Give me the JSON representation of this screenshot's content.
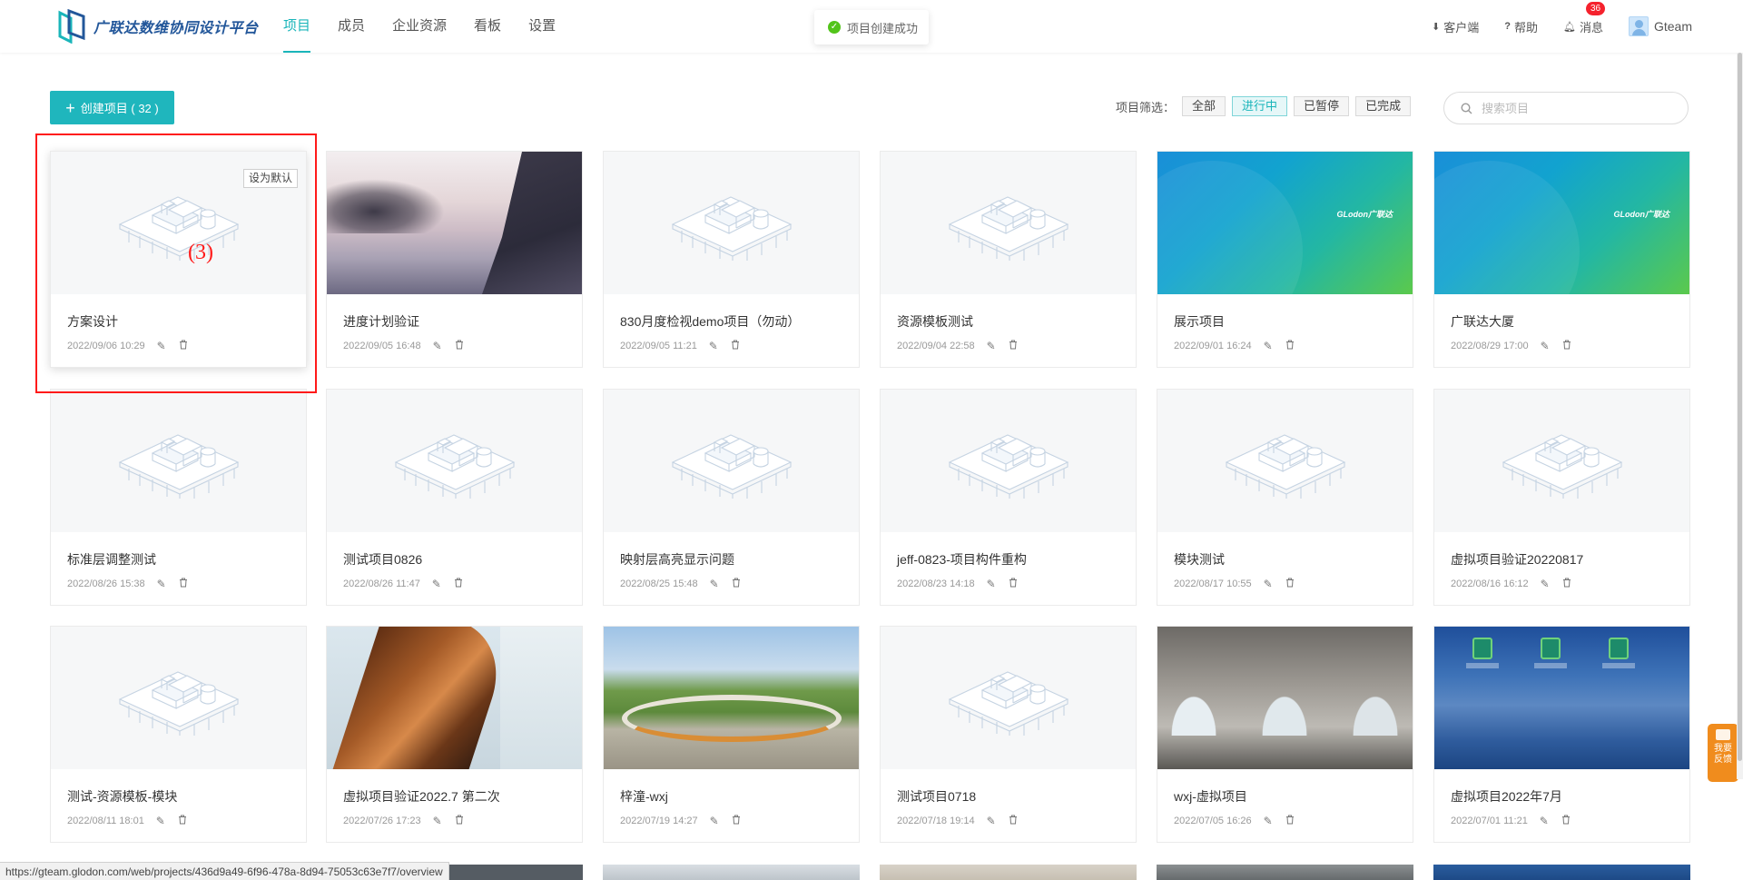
{
  "app": {
    "title": "广联达数维协同设计平台"
  },
  "nav": [
    {
      "label": "项目",
      "active": true
    },
    {
      "label": "成员",
      "active": false
    },
    {
      "label": "企业资源",
      "active": false
    },
    {
      "label": "看板",
      "active": false
    },
    {
      "label": "设置",
      "active": false
    }
  ],
  "toast": {
    "message": "项目创建成功"
  },
  "header_right": {
    "client": "客户端",
    "help": "帮助",
    "messages": "消息",
    "message_count": "36",
    "user": "Gteam"
  },
  "toolbar": {
    "create_label": "创建项目 ( 32 )",
    "filter_label": "项目筛选：",
    "filters": [
      {
        "label": "全部",
        "active": false
      },
      {
        "label": "进行中",
        "active": true
      },
      {
        "label": "已暂停",
        "active": false
      },
      {
        "label": "已完成",
        "active": false
      }
    ],
    "search_placeholder": "搜索项目"
  },
  "default_tag": "设为默认",
  "annotation": "(3)",
  "projects": [
    {
      "name": "方案设计",
      "date": "2022/09/06 10:29",
      "thumb": "placeholder"
    },
    {
      "name": "进度计划验证",
      "date": "2022/09/05 16:48",
      "thumb": "lake"
    },
    {
      "name": "830月度检视demo项目（勿动）",
      "date": "2022/09/05 11:21",
      "thumb": "placeholder"
    },
    {
      "name": "资源模板测试",
      "date": "2022/09/04 22:58",
      "thumb": "placeholder"
    },
    {
      "name": "展示项目",
      "date": "2022/09/01 16:24",
      "thumb": "glodon"
    },
    {
      "name": "广联达大厦",
      "date": "2022/08/29 17:00",
      "thumb": "glodon"
    },
    {
      "name": "标准层调整测试",
      "date": "2022/08/26 15:38",
      "thumb": "placeholder"
    },
    {
      "name": "测试项目0826",
      "date": "2022/08/26 11:47",
      "thumb": "placeholder"
    },
    {
      "name": "映射层高亮显示问题",
      "date": "2022/08/25 15:48",
      "thumb": "placeholder"
    },
    {
      "name": "jeff-0823-项目构件重构",
      "date": "2022/08/23 14:18",
      "thumb": "placeholder"
    },
    {
      "name": "模块测试",
      "date": "2022/08/17 10:55",
      "thumb": "placeholder"
    },
    {
      "name": "虚拟项目验证20220817",
      "date": "2022/08/16 16:12",
      "thumb": "placeholder"
    },
    {
      "name": "测试-资源模板-模块",
      "date": "2022/08/11 18:01",
      "thumb": "placeholder"
    },
    {
      "name": "虚拟项目验证2022.7 第二次",
      "date": "2022/07/26 17:23",
      "thumb": "arch"
    },
    {
      "name": "梓潼-wxj",
      "date": "2022/07/19 14:27",
      "thumb": "park"
    },
    {
      "name": "测试项目0718",
      "date": "2022/07/18 19:14",
      "thumb": "placeholder"
    },
    {
      "name": "wxj-虚拟项目",
      "date": "2022/07/05 16:26",
      "thumb": "vault"
    },
    {
      "name": "虚拟项目2022年7月",
      "date": "2022/07/01 11:21",
      "thumb": "desktop"
    }
  ],
  "glodon_brand": "GLodon广联达",
  "status_url": "https://gteam.glodon.com/web/projects/436d9a49-6f96-478a-8d94-75053c63e7f7/overview",
  "feedback_label": "我要反馈",
  "icons": {
    "edit": "edit-icon",
    "delete": "delete-icon",
    "search": "search-icon",
    "download": "download-icon",
    "help": "help-icon",
    "bell": "bell-icon"
  },
  "colors": {
    "accent": "#1fb6bd",
    "badge": "#f5222d",
    "feedback": "#f08c1d",
    "annotation": "#ff1a1a"
  }
}
